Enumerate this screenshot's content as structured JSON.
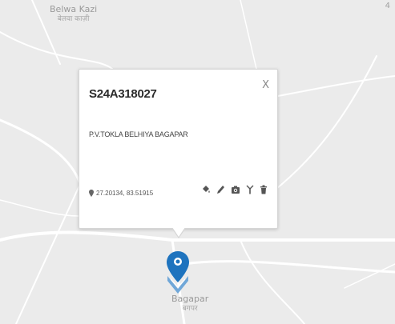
{
  "map": {
    "places": [
      {
        "name": "Belwa Kazi",
        "native": "बेलवा काज़ी"
      },
      {
        "name": "Bagapar",
        "native": "बगपर"
      }
    ],
    "corner_label": "4"
  },
  "popup": {
    "title": "S24A318027",
    "close": "X",
    "address": "P.V.TOKLA BELHIYA BAGAPAR",
    "coords": "27.20134, 83.51915",
    "actions": [
      {
        "icon": "paint-bucket-icon"
      },
      {
        "icon": "pencil-icon"
      },
      {
        "icon": "camera-icon"
      },
      {
        "icon": "antenna-icon"
      },
      {
        "icon": "trash-icon"
      }
    ]
  },
  "colors": {
    "map_bg": "#ebebeb",
    "road": "#ffffff",
    "marker_blue": "#1e73be"
  }
}
